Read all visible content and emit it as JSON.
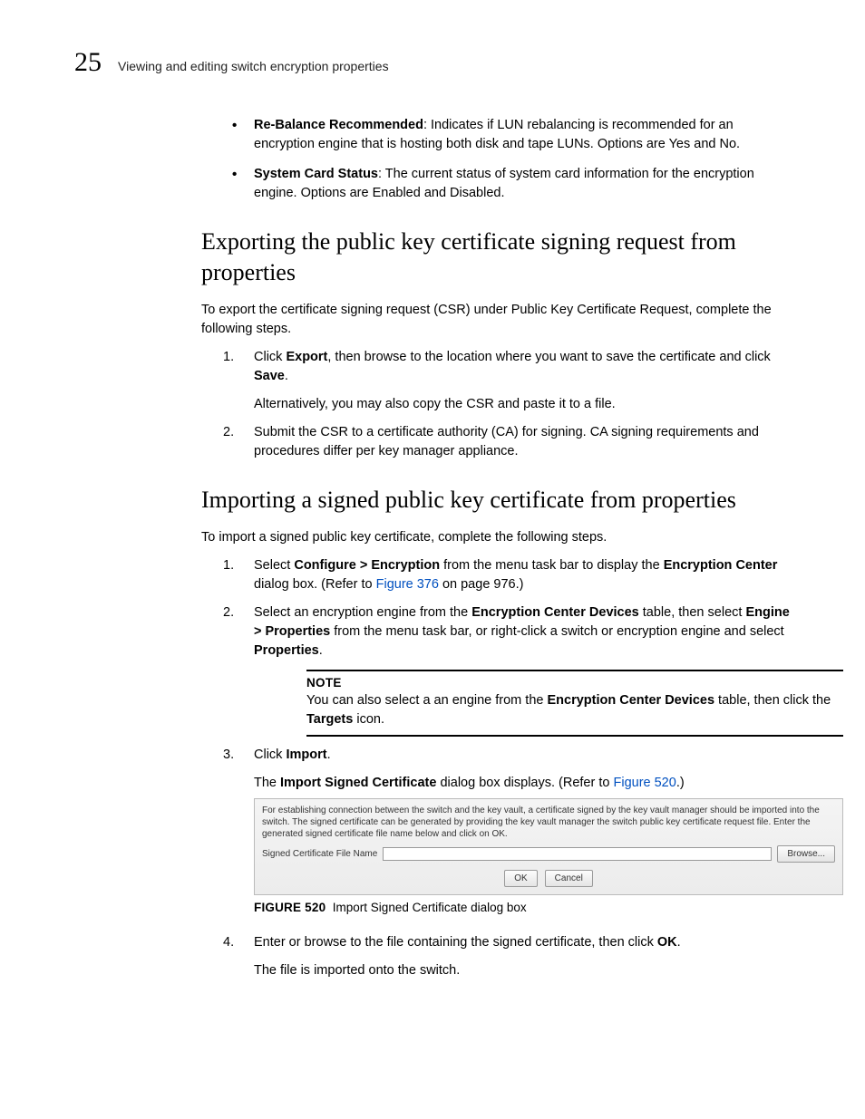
{
  "header": {
    "chapter_number": "25",
    "chapter_title": "Viewing and editing switch encryption properties"
  },
  "bullets": [
    {
      "term": "Re-Balance Recommended",
      "after_colon": ": Indicates if LUN rebalancing is recommended for an encryption engine that is hosting both disk and tape LUNs. Options are Yes and No."
    },
    {
      "term": "System Card Status",
      "after_colon": ": The current status of system card information for the encryption engine. Options are Enabled and Disabled."
    }
  ],
  "section1": {
    "title": "Exporting the public key certificate signing request from properties",
    "intro": "To export the certificate signing request (CSR) under Public Key Certificate Request, complete the following steps.",
    "step1_pre": "Click ",
    "step1_b1": "Export",
    "step1_mid": ", then browse to the location where you want to save the certificate and click ",
    "step1_b2": "Save",
    "step1_post": ".",
    "step1_alt": "Alternatively, you may also copy the CSR and paste it to a file.",
    "step2": "Submit the CSR to a certificate authority (CA) for signing. CA signing requirements and procedures differ per key manager appliance."
  },
  "section2": {
    "title": "Importing a signed public key certificate from properties",
    "intro": "To import a signed public key certificate, complete the following steps.",
    "step1_pre": "Select ",
    "step1_b1": "Configure > Encryption",
    "step1_mid": " from the menu task bar to display the ",
    "step1_b2": "Encryption Center",
    "step1_post": " dialog box. (Refer to ",
    "step1_link": "Figure 376",
    "step1_tail": " on page 976.)",
    "step2_pre": "Select an encryption engine from the ",
    "step2_b1": "Encryption Center Devices",
    "step2_mid": " table, then select ",
    "step2_b2": "Engine > Properties",
    "step2_mid2": " from the menu task bar, or right-click a switch or encryption engine and select ",
    "step2_b3": "Properties",
    "step2_post": ".",
    "note_label": "NOTE",
    "note_pre": "You can also select a an engine from the ",
    "note_b1": "Encryption Center Devices",
    "note_mid": " table, then click the ",
    "note_b2": "Targets",
    "note_post": " icon.",
    "step3_pre": "Click ",
    "step3_b1": "Import",
    "step3_post": ".",
    "step3_sub_pre": "The ",
    "step3_sub_b1": "Import Signed Certificate",
    "step3_sub_mid": " dialog box displays. (Refer to ",
    "step3_sub_link": "Figure 520",
    "step3_sub_post": ".)",
    "step4_pre": "Enter or browse to the file containing the signed certificate, then click ",
    "step4_b1": "OK",
    "step4_post": ".",
    "step4_sub": "The file is imported onto the switch."
  },
  "dialog": {
    "instructions": "For establishing connection between the switch and the key vault, a certificate signed by the key vault manager should be imported into the switch. The signed certificate can be generated by providing the key vault manager the switch public key certificate request file. Enter the generated signed certificate file name below and click on OK.",
    "field_label": "Signed Certificate File Name",
    "field_value": "",
    "browse_label": "Browse...",
    "ok_label": "OK",
    "cancel_label": "Cancel"
  },
  "figure": {
    "num": "FIGURE 520",
    "caption": "Import Signed Certificate dialog box"
  }
}
